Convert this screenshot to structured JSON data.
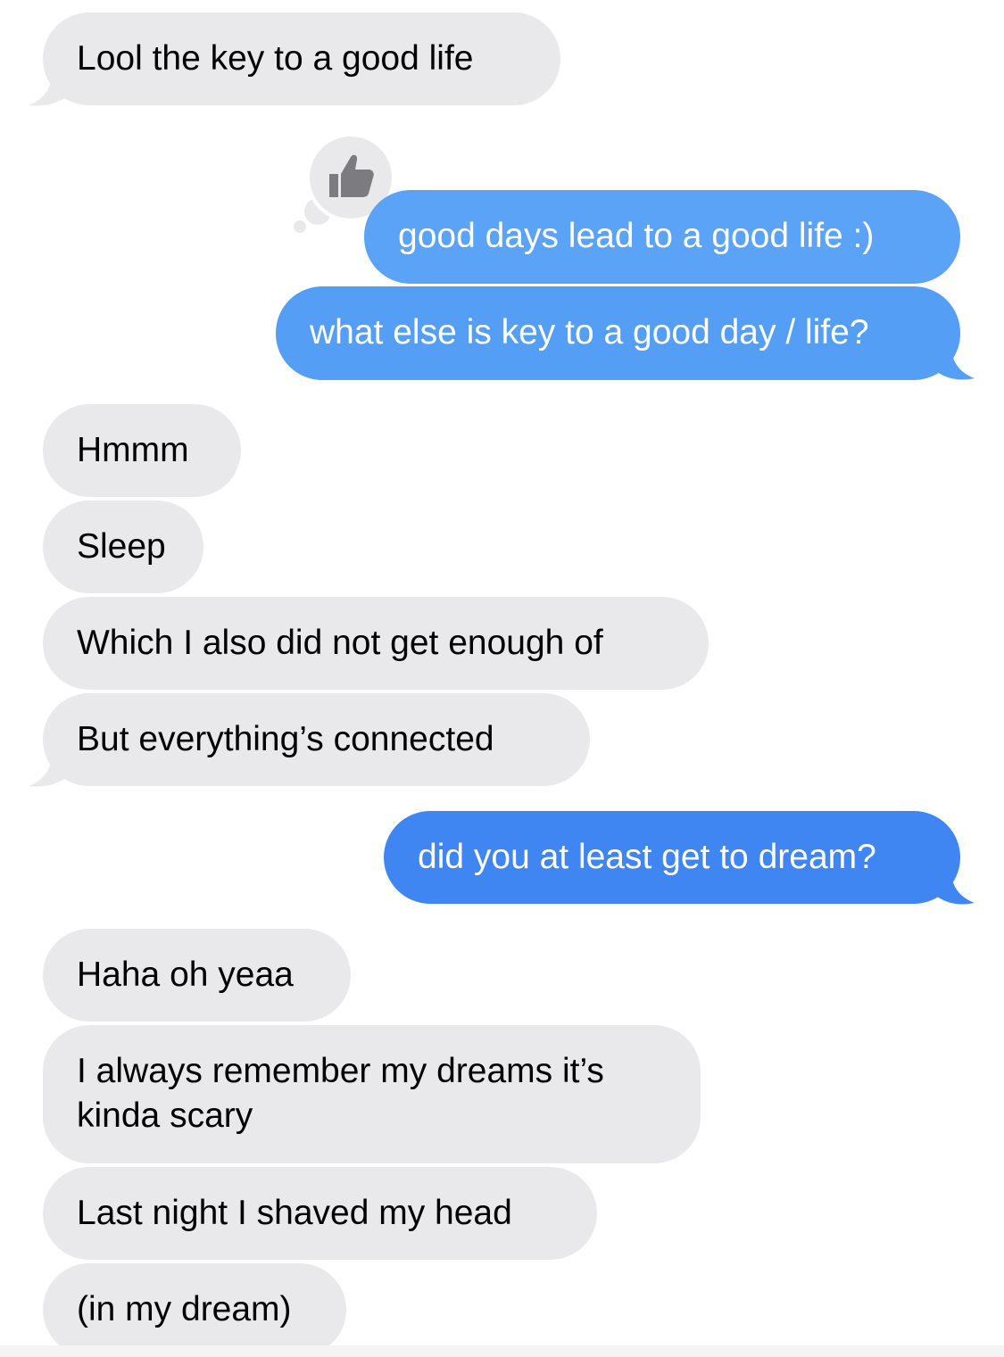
{
  "colors": {
    "incoming_bubble": "#e9e9eb",
    "outgoing_bubble_light": "#5aa3f6",
    "outgoing_bubble_mid": "#4d99f4",
    "outgoing_bubble_dark": "#3f86f2",
    "incoming_text": "#000000",
    "outgoing_text": "#ffffff",
    "reaction_icon": "#7c7c80"
  },
  "messages": [
    {
      "id": "m1",
      "direction": "incoming",
      "text": "Lool the key to a good life"
    },
    {
      "id": "m2",
      "direction": "outgoing",
      "text": "good days lead to a good life :)",
      "reaction": "thumbs-up-icon"
    },
    {
      "id": "m3",
      "direction": "outgoing",
      "text": "what else is key to a good day / life?"
    },
    {
      "id": "m4",
      "direction": "incoming",
      "text": "Hmmm"
    },
    {
      "id": "m5",
      "direction": "incoming",
      "text": "Sleep"
    },
    {
      "id": "m6",
      "direction": "incoming",
      "text": "Which I also did not get enough of"
    },
    {
      "id": "m7",
      "direction": "incoming",
      "text": "But everything’s connected"
    },
    {
      "id": "m8",
      "direction": "outgoing",
      "text": "did you at least get to dream?"
    },
    {
      "id": "m9",
      "direction": "incoming",
      "text": "Haha oh yeaa"
    },
    {
      "id": "m10",
      "direction": "incoming",
      "text": "I always remember my dreams it’s kinda scary"
    },
    {
      "id": "m11",
      "direction": "incoming",
      "text": "Last night I shaved my head"
    },
    {
      "id": "m12",
      "direction": "incoming",
      "text": "(in my dream)"
    }
  ]
}
